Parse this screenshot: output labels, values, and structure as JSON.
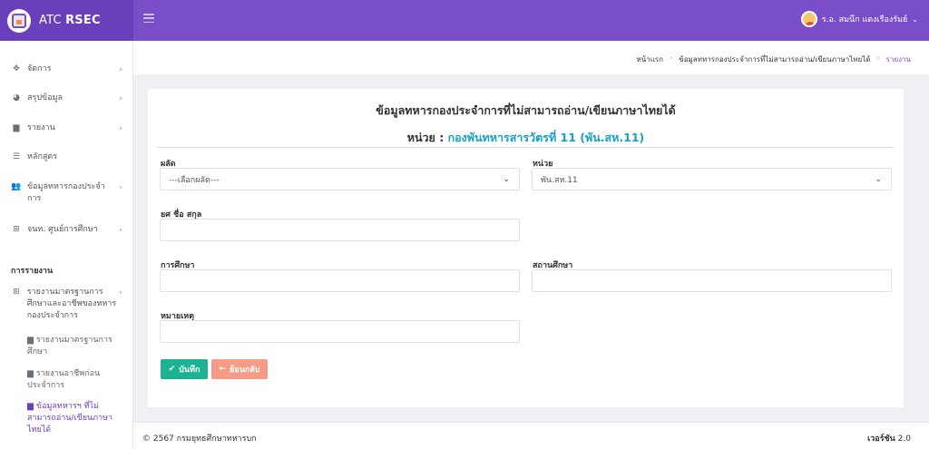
{
  "brand": {
    "name_prefix": "ATC",
    "name_bold": "RSEC"
  },
  "header": {
    "user_name": "ร.อ. สมนึก แตงเรืองรัมย์",
    "caret": "⌄"
  },
  "sidebar": {
    "items": [
      {
        "icon": "✥",
        "label": "จัดการ",
        "chevron": "›"
      },
      {
        "icon": "◕",
        "label": "สรุปข้อมูล",
        "chevron": "›"
      },
      {
        "icon": "▆",
        "label": "รายงาน",
        "chevron": "›"
      },
      {
        "icon": "☰",
        "label": "หลักสูตร"
      },
      {
        "icon": "👥",
        "label": "ข้อมูลทหารกองประจำการ",
        "chevron": "›"
      },
      {
        "icon": "⊞",
        "label": "จนท. ศูนย์การศึกษา",
        "chevron": "›"
      }
    ],
    "section_title": "การรายงาน",
    "report_group": {
      "icon": "⊞",
      "label": "รายงานมาตรฐานการศึกษาและอาชีพของทหารกองประจำการ",
      "chevron": "›"
    },
    "sub_items": [
      {
        "icon": "▆",
        "label": "รายงานมาตรฐานการศึกษา"
      },
      {
        "icon": "▆",
        "label": "รายงานอาชีพก่อนประจำการ"
      },
      {
        "icon": "▆",
        "label": "ข้อมูลทหารฯ ที่ไม่สามารถอ่าน/เขียนภาษาไทยได้"
      }
    ]
  },
  "breadcrumb": {
    "home": "หน้าแรก",
    "section": "ข้อมูลทหารกองประจำการที่ไม่สามารถอ่าน/เขียนภาษาไทยได้",
    "current": "รายงาน",
    "separator": "›"
  },
  "form": {
    "title": "ข้อมูลทหารกองประจำการที่ไม่สามารถอ่าน/เขียนภาษาไทยได้",
    "unit_prefix": "หน่วย : ",
    "unit_name": "กองพันทหารสารวัตรที่ 11 (พัน.สห.11)",
    "fields": {
      "batch": {
        "label": "ผลัด",
        "value": "---เลือกผลัด---"
      },
      "unit": {
        "label": "หน่วย",
        "value": "พัน.สห.11"
      },
      "name": {
        "label": "ยศ ชื่อ สกุล",
        "value": ""
      },
      "education": {
        "label": "การศึกษา",
        "value": ""
      },
      "school": {
        "label": "สถานศึกษา",
        "value": ""
      },
      "remark": {
        "label": "หมายเหตุ",
        "value": ""
      }
    },
    "buttons": {
      "save": "บันทึก",
      "save_icon": "✔",
      "back": "ย้อนกลับ",
      "back_icon": "←"
    }
  },
  "footer": {
    "copyright": "© 2567 กรมยุทธศึกษาทหารบก",
    "version_label": "เวอร์ชัน",
    "version": "2.0"
  },
  "colors": {
    "header": "#7a4ec9",
    "brand_bg": "#6a3fbb",
    "save_button": "#1bb394",
    "back_button": "#f59b86",
    "unit_highlight": "#17a2c7"
  }
}
